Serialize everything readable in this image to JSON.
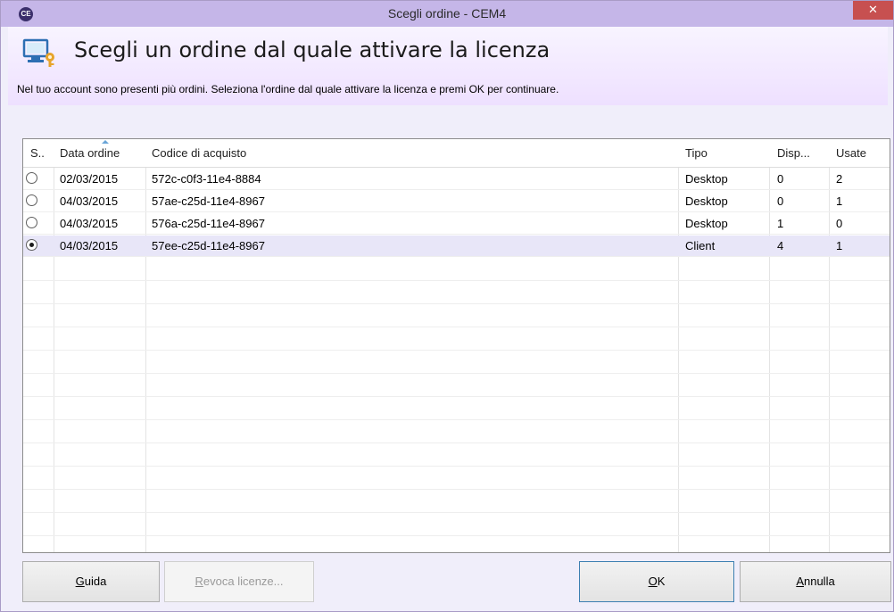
{
  "window": {
    "app_icon_text": "CE",
    "title": "Scegli ordine - CEM4",
    "close_glyph": "✕"
  },
  "header": {
    "title": "Scegli un ordine dal quale attivare la licenza",
    "icon": "computer-key-icon",
    "instruction": "Nel tuo account sono presenti più ordini. Seleziona l'ordine dal quale attivare la licenza e premi OK per continuare."
  },
  "table": {
    "columns": [
      {
        "key": "sel",
        "label": "S.."
      },
      {
        "key": "data",
        "label": "Data ordine"
      },
      {
        "key": "codice",
        "label": "Codice di acquisto"
      },
      {
        "key": "tipo",
        "label": "Tipo"
      },
      {
        "key": "disp",
        "label": "Disp..."
      },
      {
        "key": "usate",
        "label": "Usate"
      }
    ],
    "rows": [
      {
        "selected": false,
        "data": "02/03/2015",
        "codice": "572c-c0f3-11e4-8884",
        "tipo": "Desktop",
        "disp": "0",
        "usate": "2"
      },
      {
        "selected": false,
        "data": "04/03/2015",
        "codice": "57ae-c25d-11e4-8967",
        "tipo": "Desktop",
        "disp": "0",
        "usate": "1"
      },
      {
        "selected": false,
        "data": "04/03/2015",
        "codice": "576a-c25d-11e4-8967",
        "tipo": "Desktop",
        "disp": "1",
        "usate": "0"
      },
      {
        "selected": true,
        "data": "04/03/2015",
        "codice": "57ee-c25d-11e4-8967",
        "tipo": "Client",
        "disp": "4",
        "usate": "1"
      }
    ]
  },
  "buttons": {
    "guida": {
      "mnemonic": "G",
      "rest": "uida"
    },
    "revoca": {
      "mnemonic": "R",
      "rest": "evoca licenze..."
    },
    "ok": {
      "mnemonic": "O",
      "rest": "K"
    },
    "annulla": {
      "mnemonic": "A",
      "rest": "nnulla"
    }
  },
  "colors": {
    "titlebar": "#c5b6e8",
    "close": "#c75050",
    "selected_row": "#e8e6f8",
    "default_button_border": "#3c7fb1"
  }
}
